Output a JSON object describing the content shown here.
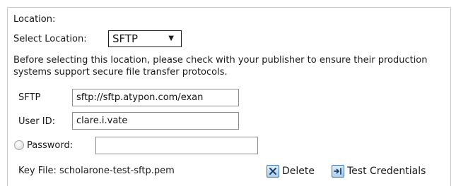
{
  "location": {
    "heading": "Location:",
    "select_label": "Select Location:",
    "selected": "SFTP",
    "arrow_glyph": "▼",
    "info": "Before selecting this location, please check with your publisher to ensure their production systems support secure file transfer protocols."
  },
  "form": {
    "sftp_label": "SFTP",
    "sftp_value": "sftp://sftp.atypon.com/exan",
    "userid_label": "User ID:",
    "userid_value": "clare.i.vate",
    "password_label": "Password:",
    "password_value": "",
    "password_selected": false,
    "keyfile_label": "Key File: scholarone-test-sftp.pem"
  },
  "actions": {
    "delete_label": "Delete",
    "delete_icon": "close-x-icon",
    "test_label": "Test Credentials",
    "test_icon": "arrow-to-line-icon"
  },
  "colors": {
    "border": "#c8c8c8",
    "icon_blue": "#3f6fa3"
  }
}
